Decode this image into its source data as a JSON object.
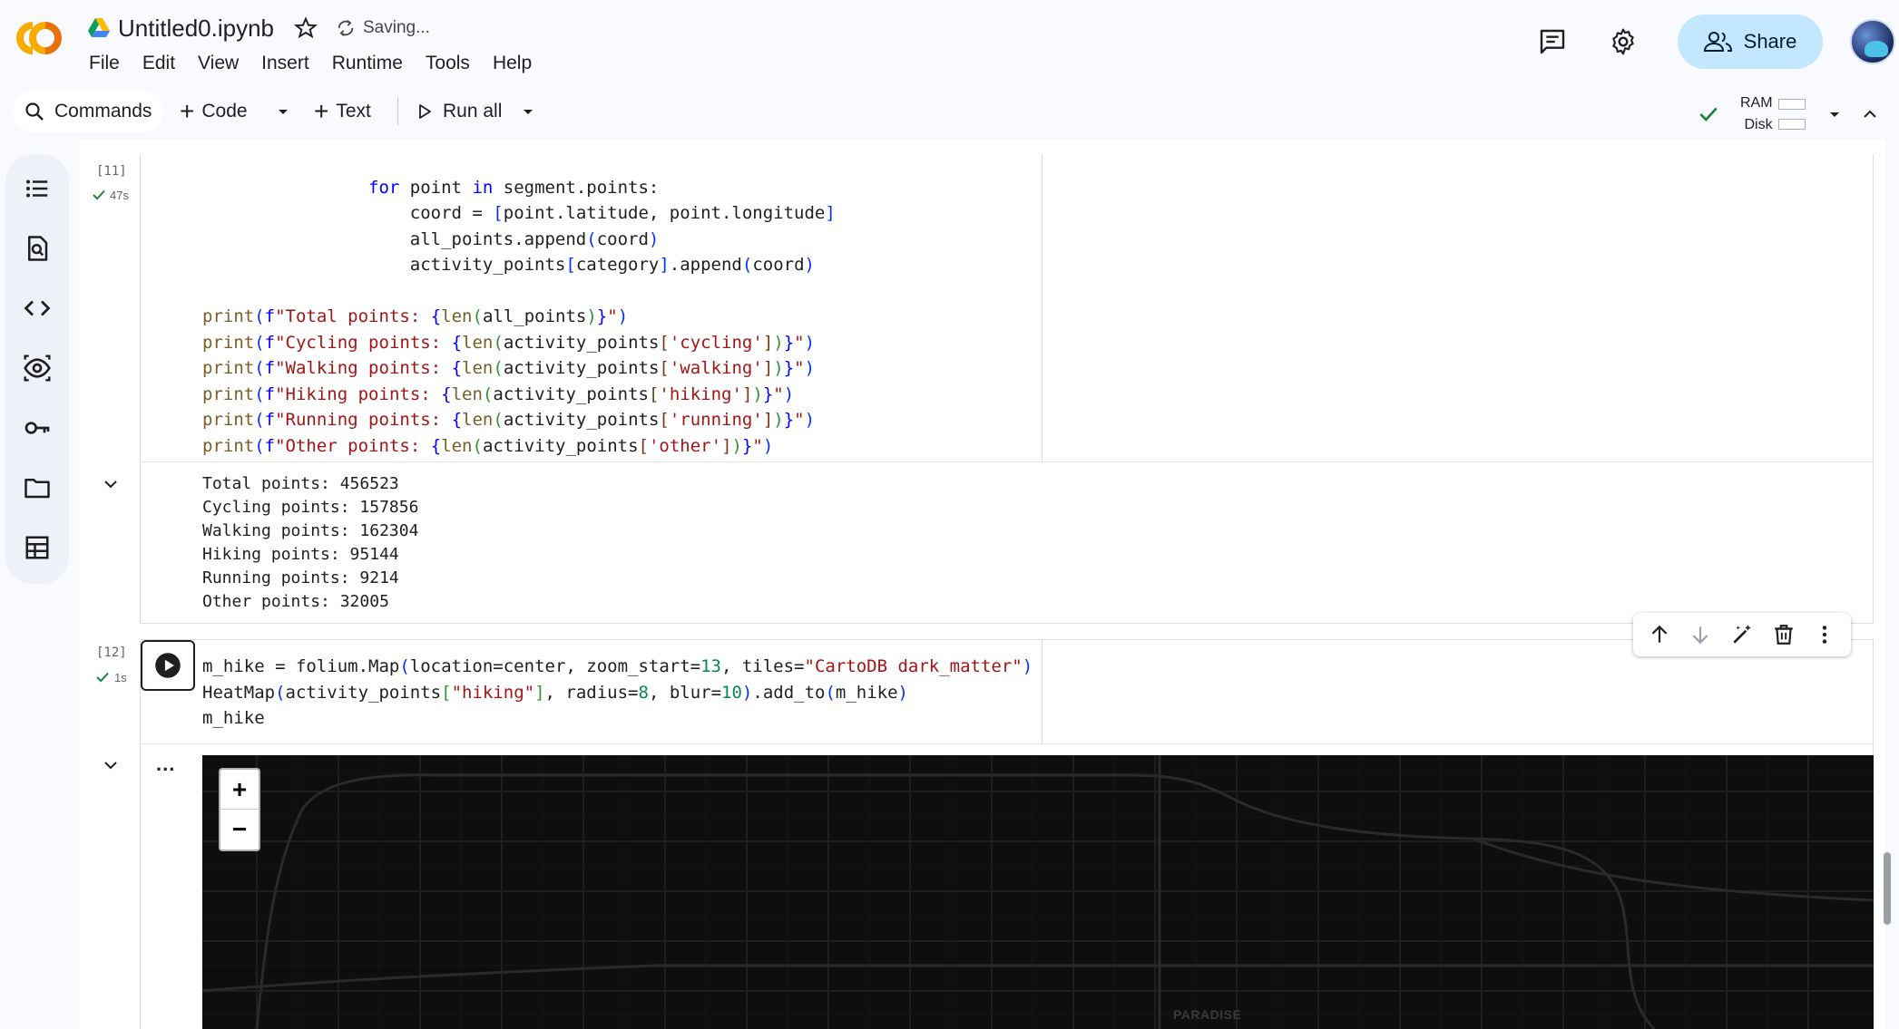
{
  "app": {
    "notebook_title": "Untitled0.ipynb",
    "save_status": "Saving...",
    "share_label": "Share"
  },
  "menu": [
    "File",
    "Edit",
    "View",
    "Insert",
    "Runtime",
    "Tools",
    "Help"
  ],
  "toolbar": {
    "commands_label": "Commands",
    "code_label": "Code",
    "text_label": "Text",
    "run_all_label": "Run all",
    "ram_label": "RAM",
    "disk_label": "Disk"
  },
  "sidebar": [
    "table-of-contents-icon",
    "find-replace-icon",
    "code-snippets-icon",
    "variables-icon",
    "secrets-key-icon",
    "files-folder-icon",
    "data-table-icon"
  ],
  "cells": [
    {
      "exec_count": "[11]",
      "exec_time": "47s",
      "code_lines": [
        "                for point in segment.points:",
        "                    coord = [point.latitude, point.longitude]",
        "                    all_points.append(coord)",
        "                    activity_points[category].append(coord)",
        "",
        "print(f\"Total points: {len(all_points)}\")",
        "print(f\"Cycling points: {len(activity_points['cycling'])}\")",
        "print(f\"Walking points: {len(activity_points['walking'])}\")",
        "print(f\"Hiking points: {len(activity_points['hiking'])}\")",
        "print(f\"Running points: {len(activity_points['running'])}\")",
        "print(f\"Other points: {len(activity_points['other'])}\")"
      ],
      "output_lines": [
        "Total points: 456523",
        "Cycling points: 157856",
        "Walking points: 162304",
        "Hiking points: 95144",
        "Running points: 9214",
        "Other points: 32005"
      ]
    },
    {
      "exec_count": "[12]",
      "exec_time": "1s",
      "code_lines": [
        "m_hike = folium.Map(location=center, zoom_start=13, tiles=\"CartoDB dark_matter\")",
        "HeatMap(activity_points[\"hiking\"], radius=8, blur=10).add_to(m_hike)",
        "m_hike"
      ],
      "output_ellipsis": "...",
      "map": {
        "zoom_in": "+",
        "zoom_out": "−",
        "place_label": "PARADISE"
      }
    }
  ]
}
